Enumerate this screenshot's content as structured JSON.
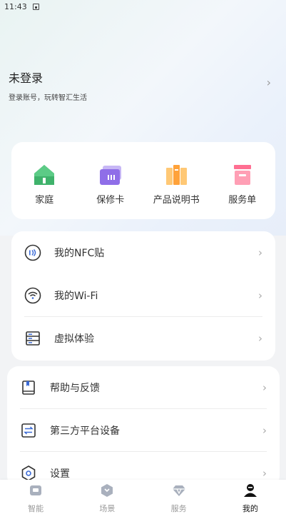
{
  "status": {
    "time": "11:43"
  },
  "login": {
    "title": "未登录",
    "subtitle": "登录账号，玩转智汇生活"
  },
  "quick_actions": [
    {
      "label": "家庭",
      "icon": "home-icon"
    },
    {
      "label": "保修卡",
      "icon": "warranty-card-icon"
    },
    {
      "label": "产品说明书",
      "icon": "manual-icon"
    },
    {
      "label": "服务单",
      "icon": "service-order-icon"
    }
  ],
  "devices_list": [
    {
      "label": "我的NFC贴",
      "icon": "nfc-icon"
    },
    {
      "label": "我的Wi-Fi",
      "icon": "wifi-icon"
    },
    {
      "label": "虚拟体验",
      "icon": "server-icon"
    }
  ],
  "more_list": [
    {
      "label": "帮助与反馈",
      "icon": "book-icon"
    },
    {
      "label": "第三方平台设备",
      "icon": "transfer-icon"
    },
    {
      "label": "设置",
      "icon": "settings-icon"
    }
  ],
  "bottom_nav": [
    {
      "label": "智能",
      "icon": "smart-icon"
    },
    {
      "label": "场景",
      "icon": "scene-icon"
    },
    {
      "label": "服务",
      "icon": "diamond-icon"
    },
    {
      "label": "我的",
      "icon": "profile-icon",
      "active": true
    }
  ]
}
